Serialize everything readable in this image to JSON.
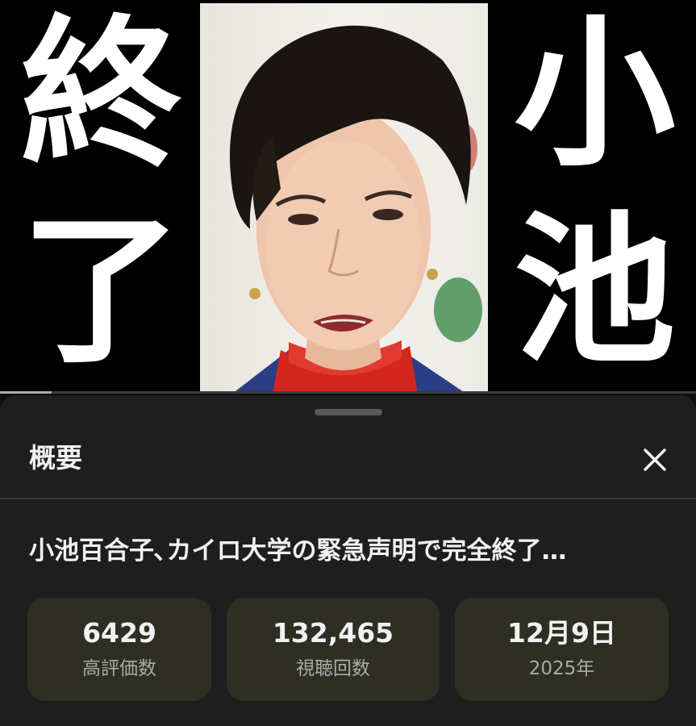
{
  "thumbnail": {
    "left_text": [
      "終",
      "了"
    ],
    "right_text": [
      "小",
      "池"
    ],
    "photo": "portrait-photo",
    "progress_fraction": 0.074
  },
  "sheet": {
    "title": "概要",
    "close_icon": "close-icon"
  },
  "video": {
    "title": "小池百合子､カイロ大学の緊急声明で完全終了…"
  },
  "stats": [
    {
      "value": "6429",
      "label": "高評価数"
    },
    {
      "value": "132,465",
      "label": "視聴回数"
    },
    {
      "value": "12月9日",
      "label": "2025年"
    }
  ],
  "colors": {
    "background": "#0f0f0f",
    "sheet": "#1e1e1e",
    "stat_card": "#2e2f22",
    "primary_text": "#f1f1f1",
    "secondary_text": "#aaaaaa"
  }
}
